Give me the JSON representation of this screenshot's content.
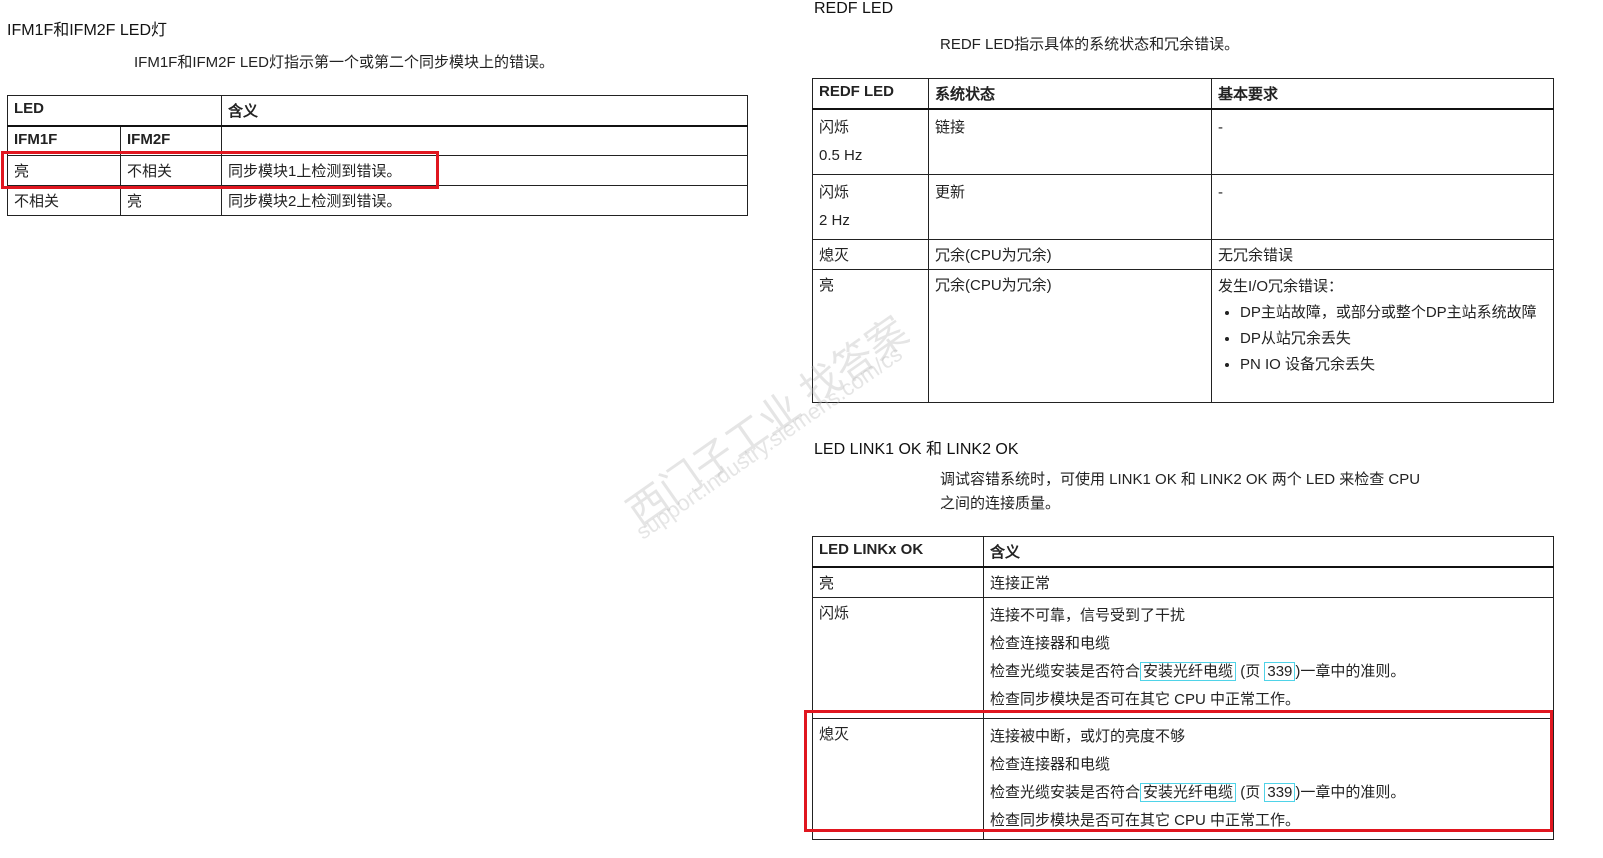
{
  "left": {
    "heading": "IFM1F和IFM2F LED灯",
    "desc": "IFM1F和IFM2F LED灯指示第一个或第二个同步模块上的错误。",
    "table": {
      "h1": "LED",
      "h2": "含义",
      "sub1": "IFM1F",
      "sub2": "IFM2F",
      "rows": [
        [
          "亮",
          "不相关",
          "同步模块1上检测到错误。"
        ],
        [
          "不相关",
          "亮",
          "同步模块2上检测到错误。"
        ]
      ]
    }
  },
  "redf": {
    "heading": "REDF LED",
    "desc": "REDF LED指示具体的系统状态和冗余错误。",
    "headers": [
      "REDF LED",
      "系统状态",
      "基本要求"
    ],
    "rows": [
      {
        "led1": "闪烁",
        "led2": "0.5 Hz",
        "state": "链接",
        "req": "-"
      },
      {
        "led1": "闪烁",
        "led2": "2 Hz",
        "state": "更新",
        "req": "-"
      },
      {
        "led1": "熄灭",
        "state": "冗余(CPU为冗余)",
        "req": "无冗余错误"
      },
      {
        "led1": "亮",
        "state": "冗余(CPU为冗余)",
        "req": "发生I/O冗余错误：",
        "bullets": [
          "DP主站故障，或部分或整个DP主站系统故障",
          "DP从站冗余丢失",
          "PN IO 设备冗余丢失"
        ]
      }
    ]
  },
  "link": {
    "heading": "LED LINK1 OK 和 LINK2 OK",
    "desc1": "调试容错系统时，可使用 LINK1 OK 和 LINK2 OK 两个 LED 来检查 CPU",
    "desc2": "之间的连接质量。",
    "h1": "LED LINKx OK",
    "h2": "含义",
    "row1": {
      "led": "亮",
      "meaning": "连接正常"
    },
    "row2": {
      "led": "闪烁",
      "l1": "连接不可靠，信号受到了干扰",
      "l2": "检查连接器和电缆",
      "l3a": "检查光缆安装是否符合",
      "l3link": "安装光纤电缆",
      "l3b": " (页 ",
      "l3page": "339",
      "l3c": ")一章中的准则。",
      "l4": "检查同步模块是否可在其它 CPU 中正常工作。"
    },
    "row3": {
      "led": "熄灭",
      "l1": "连接被中断，或灯的亮度不够",
      "l2": "检查连接器和电缆",
      "l3a": "检查光缆安装是否符合",
      "l3link": "安装光纤电缆",
      "l3b": " (页 ",
      "l3page": "339",
      "l3c": ")一章中的准则。",
      "l4": "检查同步模块是否可在其它 CPU 中正常工作。"
    }
  },
  "watermark": {
    "cn": "西门子工业 找答案",
    "url": "support.industry.siemens.com/cs"
  },
  "colors": {
    "highlight": "#e0161f",
    "link_border": "#4fd3e8"
  }
}
